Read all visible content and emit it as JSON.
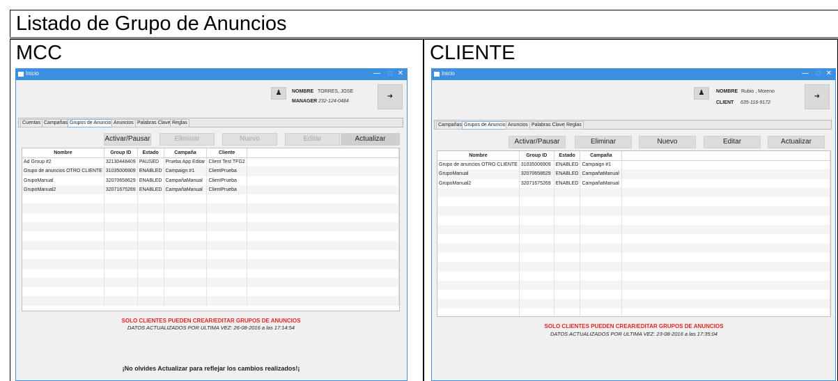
{
  "page_title": "Listado de Grupo de Anuncios",
  "mcc": {
    "panel_label": "MCC",
    "window": {
      "title": "Inicio",
      "ctl_min": "—",
      "ctl_max": "□",
      "ctl_close": "✕"
    },
    "user": {
      "name_label": "NOMBRE",
      "name": "TORRES, JOSE",
      "role_label": "MANAGER",
      "phone": "232-124-0484",
      "user_icon": "user-icon",
      "logout_icon": "logout-icon"
    },
    "tabs": [
      "Cuentas",
      "Campañas",
      "Grupos de Anuncios",
      "Anuncios",
      "Palabras Clave",
      "Reglas"
    ],
    "active_tab": "Grupos de Anuncios",
    "buttons": {
      "toggle": "Activar/Pausar",
      "delete": "Eliminar",
      "new": "Nuevo",
      "edit": "Editar",
      "refresh": "Actualizar"
    },
    "table": {
      "headers": [
        "Nombre",
        "Group ID",
        "Estado",
        "Campaña",
        "Cliente"
      ],
      "rows": [
        [
          "Ad Group #2",
          "32130448409",
          "PAUSED",
          "Prueba App Editar",
          "Client Test TFG2"
        ],
        [
          "Grupo de anuncios OTRO CLIENTE",
          "31035006909",
          "ENABLED",
          "Campaign #1",
          "ClientPrueba"
        ],
        [
          "GrupoManual",
          "32070658629",
          "ENABLED",
          "CampañaManual",
          "ClientPrueba"
        ],
        [
          "GrupoManual2",
          "32071675269",
          "ENABLED",
          "CampañaManual",
          "ClientPrueba"
        ]
      ]
    },
    "warning": "SOLO CLIENTES PUEDEN CREAR/EDITAR GRUPOS DE ANUNCIOS",
    "updated": "DATOS ACTUALIZADOS POR ULTIMA VEZ: 26-08-2016 a las 17:14:54",
    "reminder": "¡No olvides Actualizar para reflejar los cambios realizados!¡"
  },
  "cliente": {
    "panel_label": "CLIENTE",
    "window": {
      "title": "Inicio",
      "ctl_min": "—",
      "ctl_max": "□",
      "ctl_close": "✕"
    },
    "user": {
      "name_label": "NOMBRE",
      "name": "Rubio , Moreno",
      "role_label": "CLIENT",
      "phone": "635-116-9172",
      "user_icon": "user-icon",
      "logout_icon": "logout-icon"
    },
    "tabs": [
      "Campañas",
      "Grupos de Anuncios",
      "Anuncios",
      "Palabras Clave",
      "Reglas"
    ],
    "active_tab": "Grupos de Anuncios",
    "buttons": {
      "toggle": "Activar/Pausar",
      "delete": "Eliminar",
      "new": "Nuevo",
      "edit": "Editar",
      "refresh": "Actualizar"
    },
    "table": {
      "headers": [
        "Nombre",
        "Group ID",
        "Estado",
        "Campaña"
      ],
      "rows": [
        [
          "Grupo de anuncios OTRO CLIENTE",
          "31035006909",
          "ENABLED",
          "Campaign #1"
        ],
        [
          "GrupoManual",
          "32070658629",
          "ENABLED",
          "CampañaManual"
        ],
        [
          "GrupoManual2",
          "32071675269",
          "ENABLED",
          "CampañaManual"
        ]
      ]
    },
    "warning": "SOLO CLIENTES PUEDEN CREAR/EDITAR GRUPOS DE ANUNCIOS",
    "updated": "DATOS ACTUALIZADOS POR ULTIMA VEZ: 23-08-2016 a las 17:35:04"
  },
  "colors": {
    "accent": "#3d8fe0",
    "warning": "#e8231c",
    "window_bg": "#f0f0f0"
  }
}
